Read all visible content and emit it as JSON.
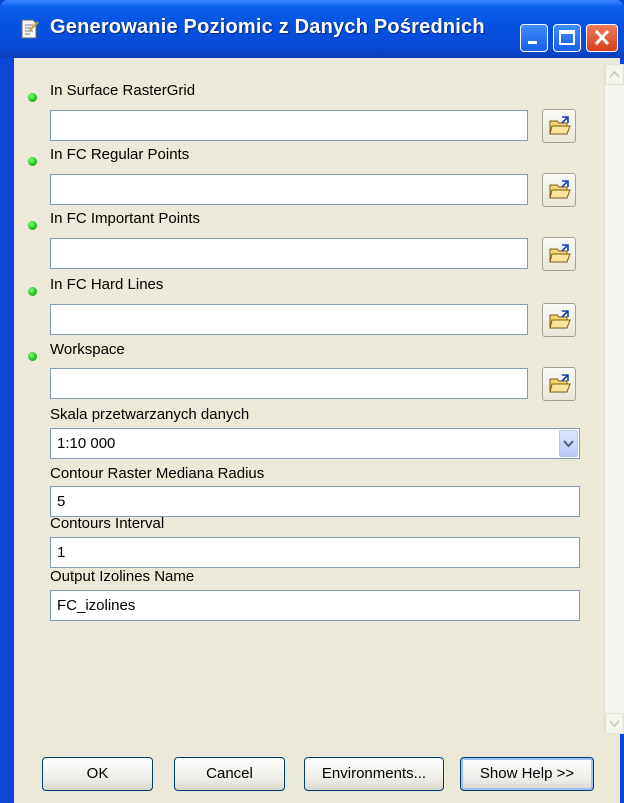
{
  "window": {
    "title": "Generowanie Poziomic z Danych Pośrednich",
    "icon": "tool-script-icon",
    "controls": [
      "minimize-icon",
      "maximize-icon",
      "close-icon"
    ]
  },
  "params": {
    "surface": {
      "label": "In Surface RasterGrid",
      "value": "",
      "required": true
    },
    "regular_points": {
      "label": "In FC Regular Points",
      "value": "",
      "required": true
    },
    "important_points": {
      "label": "In FC Important Points",
      "value": "",
      "required": true
    },
    "hard_lines": {
      "label": "In FC Hard Lines",
      "value": "",
      "required": true
    },
    "workspace": {
      "label": "Workspace",
      "value": "",
      "required": true
    },
    "scale": {
      "label": "Skala przetwarzanych danych",
      "value": "1:10 000"
    },
    "median_radius": {
      "label": "Contour Raster Mediana Radius",
      "value": "5"
    },
    "interval": {
      "label": "Contours Interval",
      "value": "1"
    },
    "output_name": {
      "label": "Output Izolines Name",
      "value": "FC_izolines"
    }
  },
  "buttons": {
    "ok": "OK",
    "cancel": "Cancel",
    "environments": "Environments...",
    "help": "Show Help >>"
  },
  "colors": {
    "title_bar": "#0a5fe8",
    "dialog_bg": "#ece9d8",
    "required_dot": "#13b313",
    "field_border": "#7f9db9"
  }
}
